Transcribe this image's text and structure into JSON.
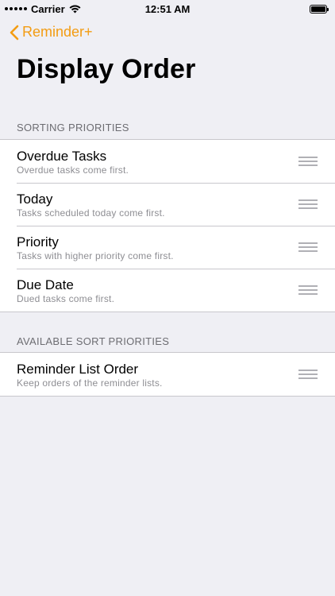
{
  "status_bar": {
    "carrier": "Carrier",
    "time": "12:51 AM"
  },
  "nav": {
    "back_label": "Reminder+",
    "title": "Display Order",
    "accent_color": "#f39c12"
  },
  "sections": [
    {
      "header": "SORTING PRIORITIES",
      "items": [
        {
          "title": "Overdue Tasks",
          "subtitle": "Overdue tasks come first."
        },
        {
          "title": "Today",
          "subtitle": "Tasks scheduled today come first."
        },
        {
          "title": "Priority",
          "subtitle": "Tasks with higher priority come first."
        },
        {
          "title": "Due Date",
          "subtitle": "Dued tasks come first."
        }
      ]
    },
    {
      "header": "AVAILABLE SORT PRIORITIES",
      "items": [
        {
          "title": "Reminder List Order",
          "subtitle": "Keep orders of the reminder lists."
        }
      ]
    }
  ],
  "icons": {
    "back": "chevron-left-icon",
    "reorder": "reorder-handle-icon",
    "wifi": "wifi-icon",
    "battery": "battery-icon"
  }
}
